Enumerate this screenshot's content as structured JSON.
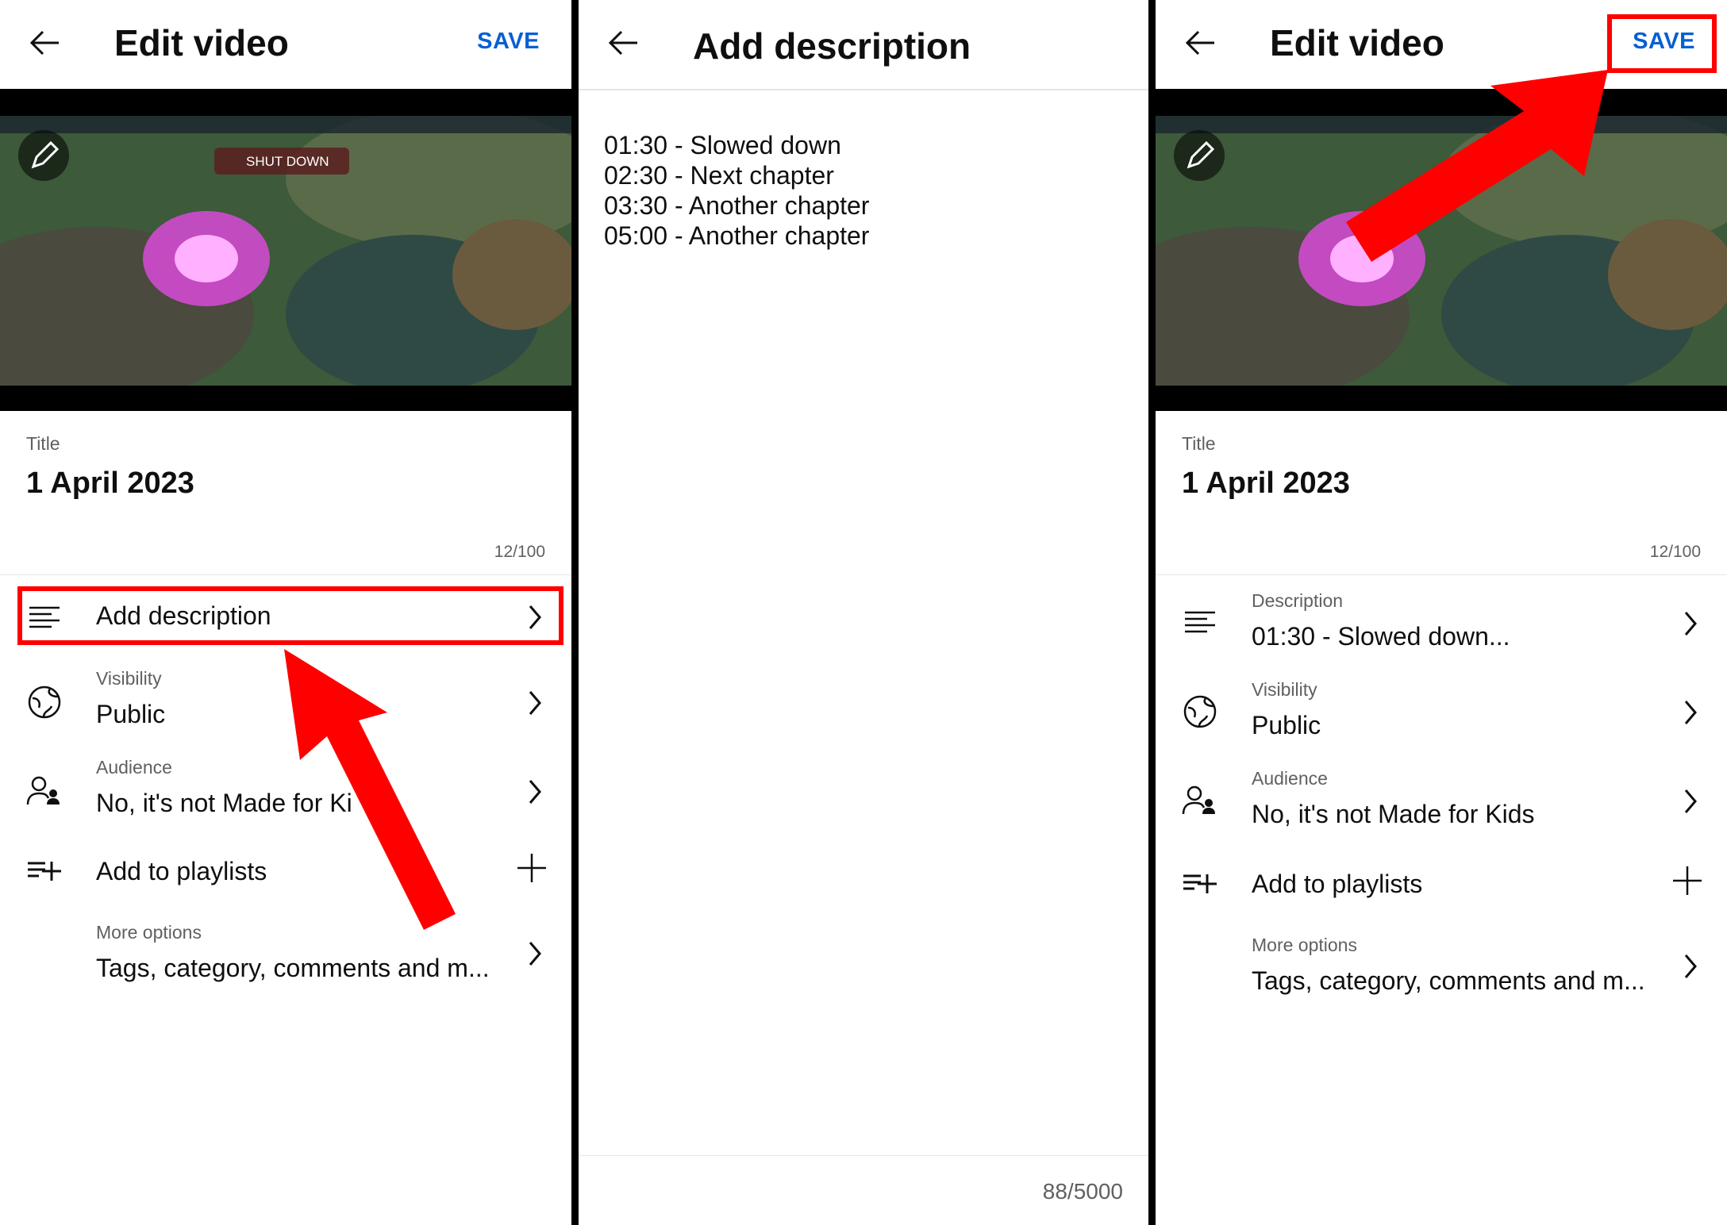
{
  "panel1": {
    "header": {
      "title": "Edit video",
      "save_label": "SAVE"
    },
    "title_field": {
      "label": "Title",
      "value": "1 April 2023",
      "counter": "12/100"
    },
    "rows": {
      "description": {
        "value": "Add description"
      },
      "visibility": {
        "label": "Visibility",
        "value": "Public"
      },
      "audience": {
        "label": "Audience",
        "value": "No, it's not Made for Ki"
      },
      "playlists": {
        "value": "Add to playlists"
      },
      "more": {
        "label": "More options",
        "value": "Tags, category, comments and m..."
      }
    }
  },
  "panel2": {
    "header": {
      "title": "Add description"
    },
    "lines": [
      "01:30 - Slowed down",
      "02:30 - Next chapter",
      "03:30 - Another chapter",
      "05:00 - Another chapter"
    ],
    "counter": "88/5000"
  },
  "panel3": {
    "header": {
      "title": "Edit video",
      "save_label": "SAVE"
    },
    "title_field": {
      "label": "Title",
      "value": "1 April 2023",
      "counter": "12/100"
    },
    "rows": {
      "description": {
        "label": "Description",
        "value": "01:30 - Slowed down..."
      },
      "visibility": {
        "label": "Visibility",
        "value": "Public"
      },
      "audience": {
        "label": "Audience",
        "value": "No, it's not Made for Kids"
      },
      "playlists": {
        "value": "Add to playlists"
      },
      "more": {
        "label": "More options",
        "value": "Tags, category, comments and m..."
      }
    }
  },
  "video_overlay_text": "SHUT DOWN",
  "colors": {
    "accent": "#065fd4",
    "highlight": "#ff0000",
    "text": "#0f0f0f",
    "secondary": "#606060"
  }
}
